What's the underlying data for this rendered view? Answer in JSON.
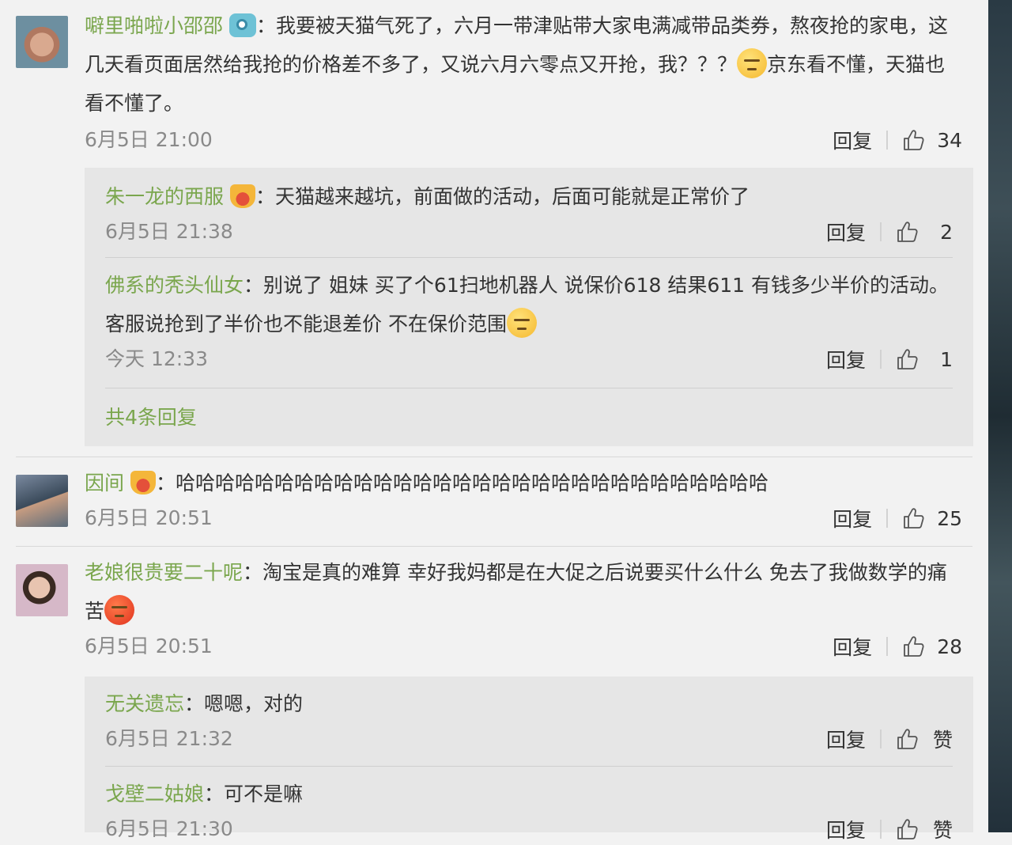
{
  "labels": {
    "reply": "回复"
  },
  "c1": {
    "user": "噼里啪啦小邵邵",
    "colon": "：",
    "text_a": "我要被天猫气死了，六月一带津贴带大家电满减带品类券，熬夜抢的家电，这几天看页面居然给我抢的价格差不多了，又说六月六零点又开抢，我？？？",
    "text_b": "京东看不懂，天猫也看不懂了。",
    "time": "6月5日 21:00",
    "likes": "34",
    "replies": [
      {
        "user": "朱一龙的西服",
        "colon": "：",
        "text": "天猫越来越坑，前面做的活动，后面可能就是正常价了",
        "time": "6月5日 21:38",
        "likes": "2"
      },
      {
        "user": "佛系的秃头仙女",
        "colon": "：",
        "text": "别说了 姐妹 买了个61扫地机器人 说保价618 结果611 有钱多少半价的活动。客服说抢到了半价也不能退差价 不在保价范围",
        "time": "今天 12:33",
        "likes": "1"
      }
    ],
    "more": "共4条回复"
  },
  "c2": {
    "user": "因间",
    "colon": "：",
    "text": "哈哈哈哈哈哈哈哈哈哈哈哈哈哈哈哈哈哈哈哈哈哈哈哈哈哈哈哈哈哈",
    "time": "6月5日 20:51",
    "likes": "25"
  },
  "c3": {
    "user": "老娘很贵要二十呢",
    "colon": "：",
    "text": "淘宝是真的难算 幸好我妈都是在大促之后说要买什么什么 免去了我做数学的痛苦",
    "time": "6月5日 20:51",
    "likes": "28",
    "replies": [
      {
        "user": "无关遗忘",
        "colon": "：",
        "text": "嗯嗯，对的",
        "time": "6月5日 21:32",
        "likes": "赞"
      },
      {
        "user": "戈壁二姑娘",
        "colon": "：",
        "text": "可不是嘛",
        "time": "6月5日 21:30",
        "likes": "赞"
      }
    ]
  }
}
